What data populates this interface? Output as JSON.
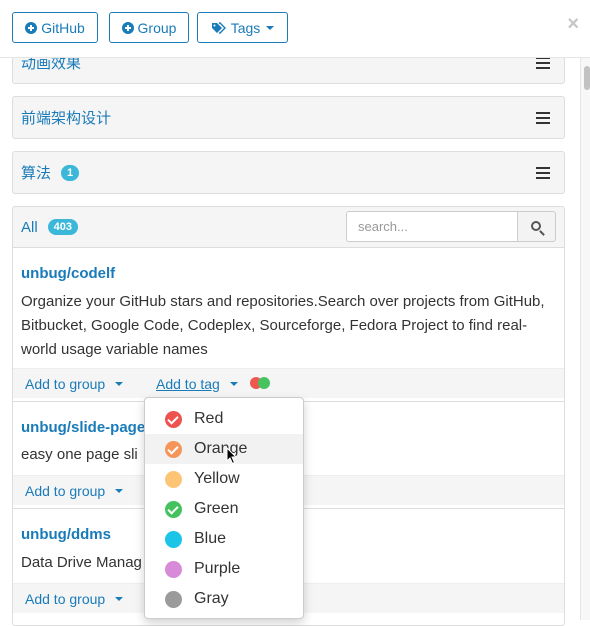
{
  "toolbar": {
    "github_label": "GitHub",
    "group_label": "Group",
    "tags_label": "Tags",
    "close_symbol": "×"
  },
  "groups": [
    {
      "name": "动画效果"
    },
    {
      "name": "前端架构设计"
    },
    {
      "name": "算法",
      "count": "1"
    }
  ],
  "list": {
    "all_label": "All",
    "all_count": "403",
    "search_placeholder": "search..."
  },
  "repos": [
    {
      "name": "unbug/codelf",
      "description": "Organize your GitHub stars and repositories.Search over projects from GitHub, Bitbucket, Google Code, Codeplex, Sourceforge, Fedora Project to find real-world usage variable names",
      "add_group": "Add to group",
      "add_tag": "Add to tag"
    },
    {
      "name": "unbug/slide-page",
      "description": "easy one page sli",
      "add_group": "Add to group"
    },
    {
      "name": "unbug/ddms",
      "description": "Data Drive Manag",
      "add_group": "Add to group"
    }
  ],
  "tag_indicator_colors": [
    "#f0574f",
    "#46c35f"
  ],
  "tags": [
    {
      "label": "Red",
      "color": "#ef5350",
      "checked": true
    },
    {
      "label": "Orange",
      "color": "#f6955a",
      "checked": true
    },
    {
      "label": "Yellow",
      "color": "#fcc575",
      "checked": false
    },
    {
      "label": "Green",
      "color": "#45c25e",
      "checked": true
    },
    {
      "label": "Blue",
      "color": "#1cc4e8",
      "checked": false
    },
    {
      "label": "Purple",
      "color": "#d68ad8",
      "checked": false
    },
    {
      "label": "Gray",
      "color": "#9b9b9b",
      "checked": false
    }
  ],
  "colors": {
    "accent": "#1a7bb9",
    "badge": "#3bb8d9"
  }
}
